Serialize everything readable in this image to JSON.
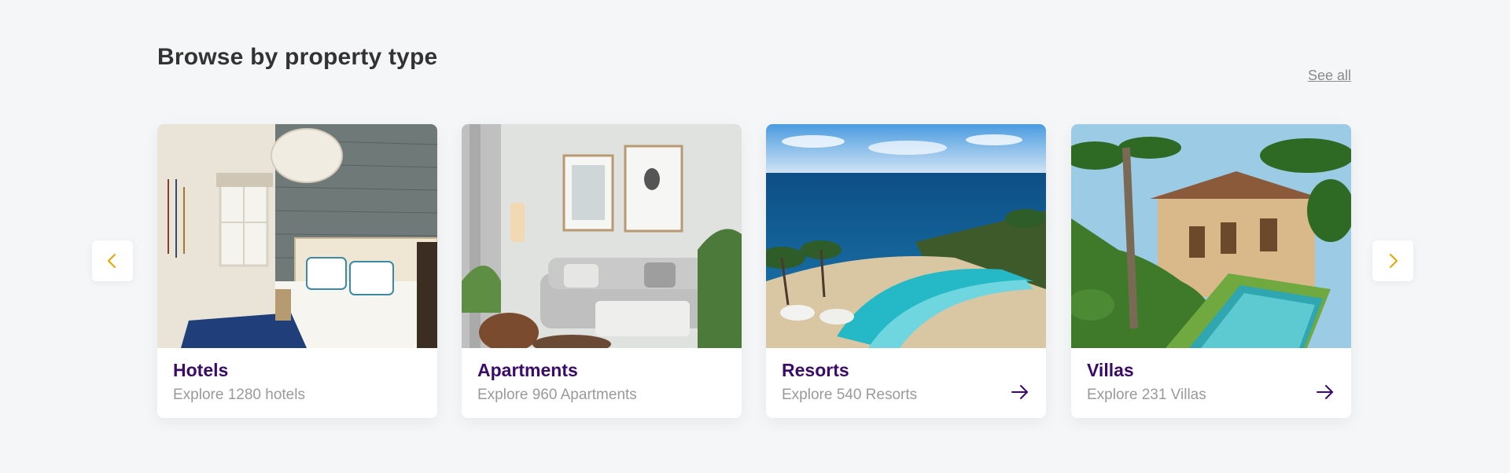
{
  "section": {
    "title": "Browse by property type",
    "see_all_label": "See all"
  },
  "nav": {
    "prev_icon": "chevron-left-icon",
    "next_icon": "chevron-right-icon",
    "accent_color": "#e8a500"
  },
  "cards": [
    {
      "title": "Hotels",
      "subtitle": "Explore 1280 hotels",
      "image": "hotel-bedroom-photo",
      "has_arrow": false
    },
    {
      "title": "Apartments",
      "subtitle": "Explore 960 Apartments",
      "image": "apartment-living-room-photo",
      "has_arrow": false
    },
    {
      "title": "Resorts",
      "subtitle": "Explore 540 Resorts",
      "image": "resort-pool-ocean-photo",
      "has_arrow": true
    },
    {
      "title": "Villas",
      "subtitle": "Explore 231 Villas",
      "image": "villa-pool-garden-photo",
      "has_arrow": true
    }
  ],
  "colors": {
    "title_purple": "#3b0a6b",
    "subtitle_gray": "#9a9a9a",
    "background": "#f5f6f8"
  }
}
